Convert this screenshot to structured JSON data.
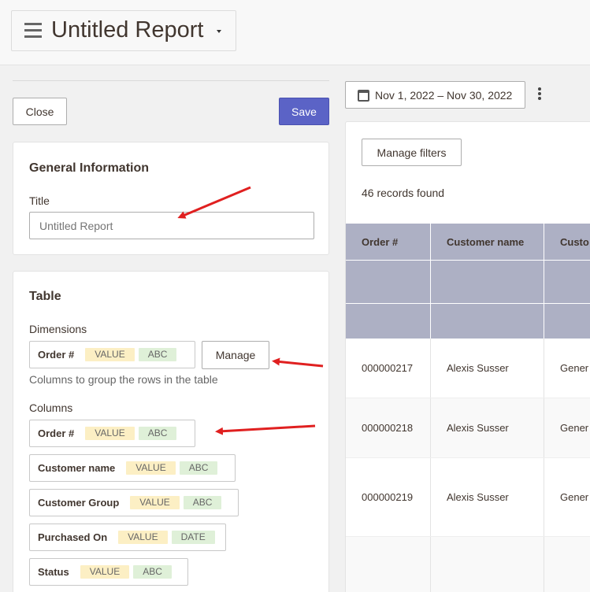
{
  "header": {
    "title": "Untitled Report"
  },
  "toolbar": {
    "close_label": "Close",
    "save_label": "Save"
  },
  "general": {
    "heading": "General Information",
    "title_label": "Title",
    "title_placeholder": "Untitled Report"
  },
  "table": {
    "heading": "Table",
    "dimensions_label": "Dimensions",
    "dimensions_hint": "Columns to group the rows in the table",
    "manage_label": "Manage",
    "columns_label": "Columns",
    "dimension": {
      "name": "Order #",
      "agg": "VALUE",
      "type": "ABC"
    },
    "columns": [
      {
        "name": "Order #",
        "agg": "VALUE",
        "type": "ABC"
      },
      {
        "name": "Customer name",
        "agg": "VALUE",
        "type": "ABC"
      },
      {
        "name": "Customer Group",
        "agg": "VALUE",
        "type": "ABC"
      },
      {
        "name": "Purchased On",
        "agg": "VALUE",
        "type": "DATE"
      },
      {
        "name": "Status",
        "agg": "VALUE",
        "type": "ABC"
      }
    ]
  },
  "date_range": {
    "label": "Nov 1, 2022 – Nov 30, 2022"
  },
  "results": {
    "manage_filters_label": "Manage filters",
    "records_found": "46 records found",
    "headers": [
      "Order #",
      "Customer name",
      "Custo"
    ],
    "rows": [
      [
        "000000217",
        "Alexis Susser",
        "Gener"
      ],
      [
        "000000218",
        "Alexis Susser",
        "Gener"
      ],
      [
        "000000219",
        "Alexis Susser",
        "Gener"
      ]
    ]
  },
  "colors": {
    "accent": "#5b63c6",
    "table_header": "#adb0c4",
    "annotation_arrow": "#e02020"
  }
}
